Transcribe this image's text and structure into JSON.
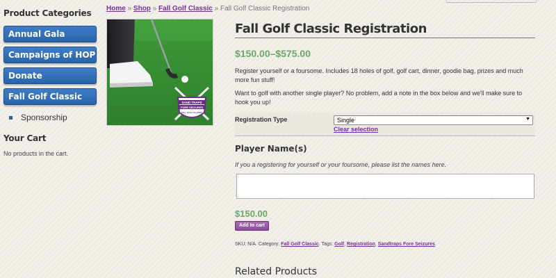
{
  "sidebar": {
    "categories_heading": "Product Categories",
    "categories": [
      {
        "label": "Annual Gala"
      },
      {
        "label": "Campaigns of HOPE"
      },
      {
        "label": "Donate"
      },
      {
        "label": "Fall Golf Classic"
      }
    ],
    "sub_item": "Sponsorship",
    "cart_heading": "Your Cart",
    "cart_empty": "No products in the cart."
  },
  "breadcrumb": {
    "items": [
      "Home",
      "Shop",
      "Fall Golf Classic"
    ],
    "separator": "»",
    "current": "Fall Golf Classic Registration"
  },
  "product": {
    "image": {
      "logo_top": "SAND TRAPS",
      "logo_mid": "FORE SEIZURES",
      "logo_bottom": "FALL GOLF CLASSIC"
    },
    "title": "Fall Golf Classic Registration",
    "price_range": "$150.00–$575.00",
    "description_1": "Register yourself or a foursome. Includes 18 holes of golf, golf cart, dinner, goodie bag, prizes and much more fun stuff!",
    "description_2": "Want to golf with another single player? No problem, add a note in the box below and we'll make sure to hook you up!",
    "variation": {
      "label": "Registration Type",
      "selected": "Single",
      "clear_label": "Clear selection"
    },
    "player_names": {
      "heading": "Player Name(s)",
      "help": "If you a registering for yourself or your foursome, please list the names here.",
      "value": ""
    },
    "selected_price": "$150.00",
    "add_to_cart": "Add to cart",
    "meta": {
      "sku_label": "SKU:",
      "sku_value": "N/A.",
      "category_label": "Category:",
      "category": "Fall Golf Classic",
      "tags_label": "Tags:",
      "tags": [
        "Golf",
        "Registration",
        "Sandtraps Fore Seizures"
      ]
    }
  },
  "related": {
    "heading": "Related Products"
  },
  "colors": {
    "category_button": "#2a64a8",
    "link": "#7a2e9a",
    "price": "#6ea56a",
    "add_to_cart": "#8c4c99"
  }
}
